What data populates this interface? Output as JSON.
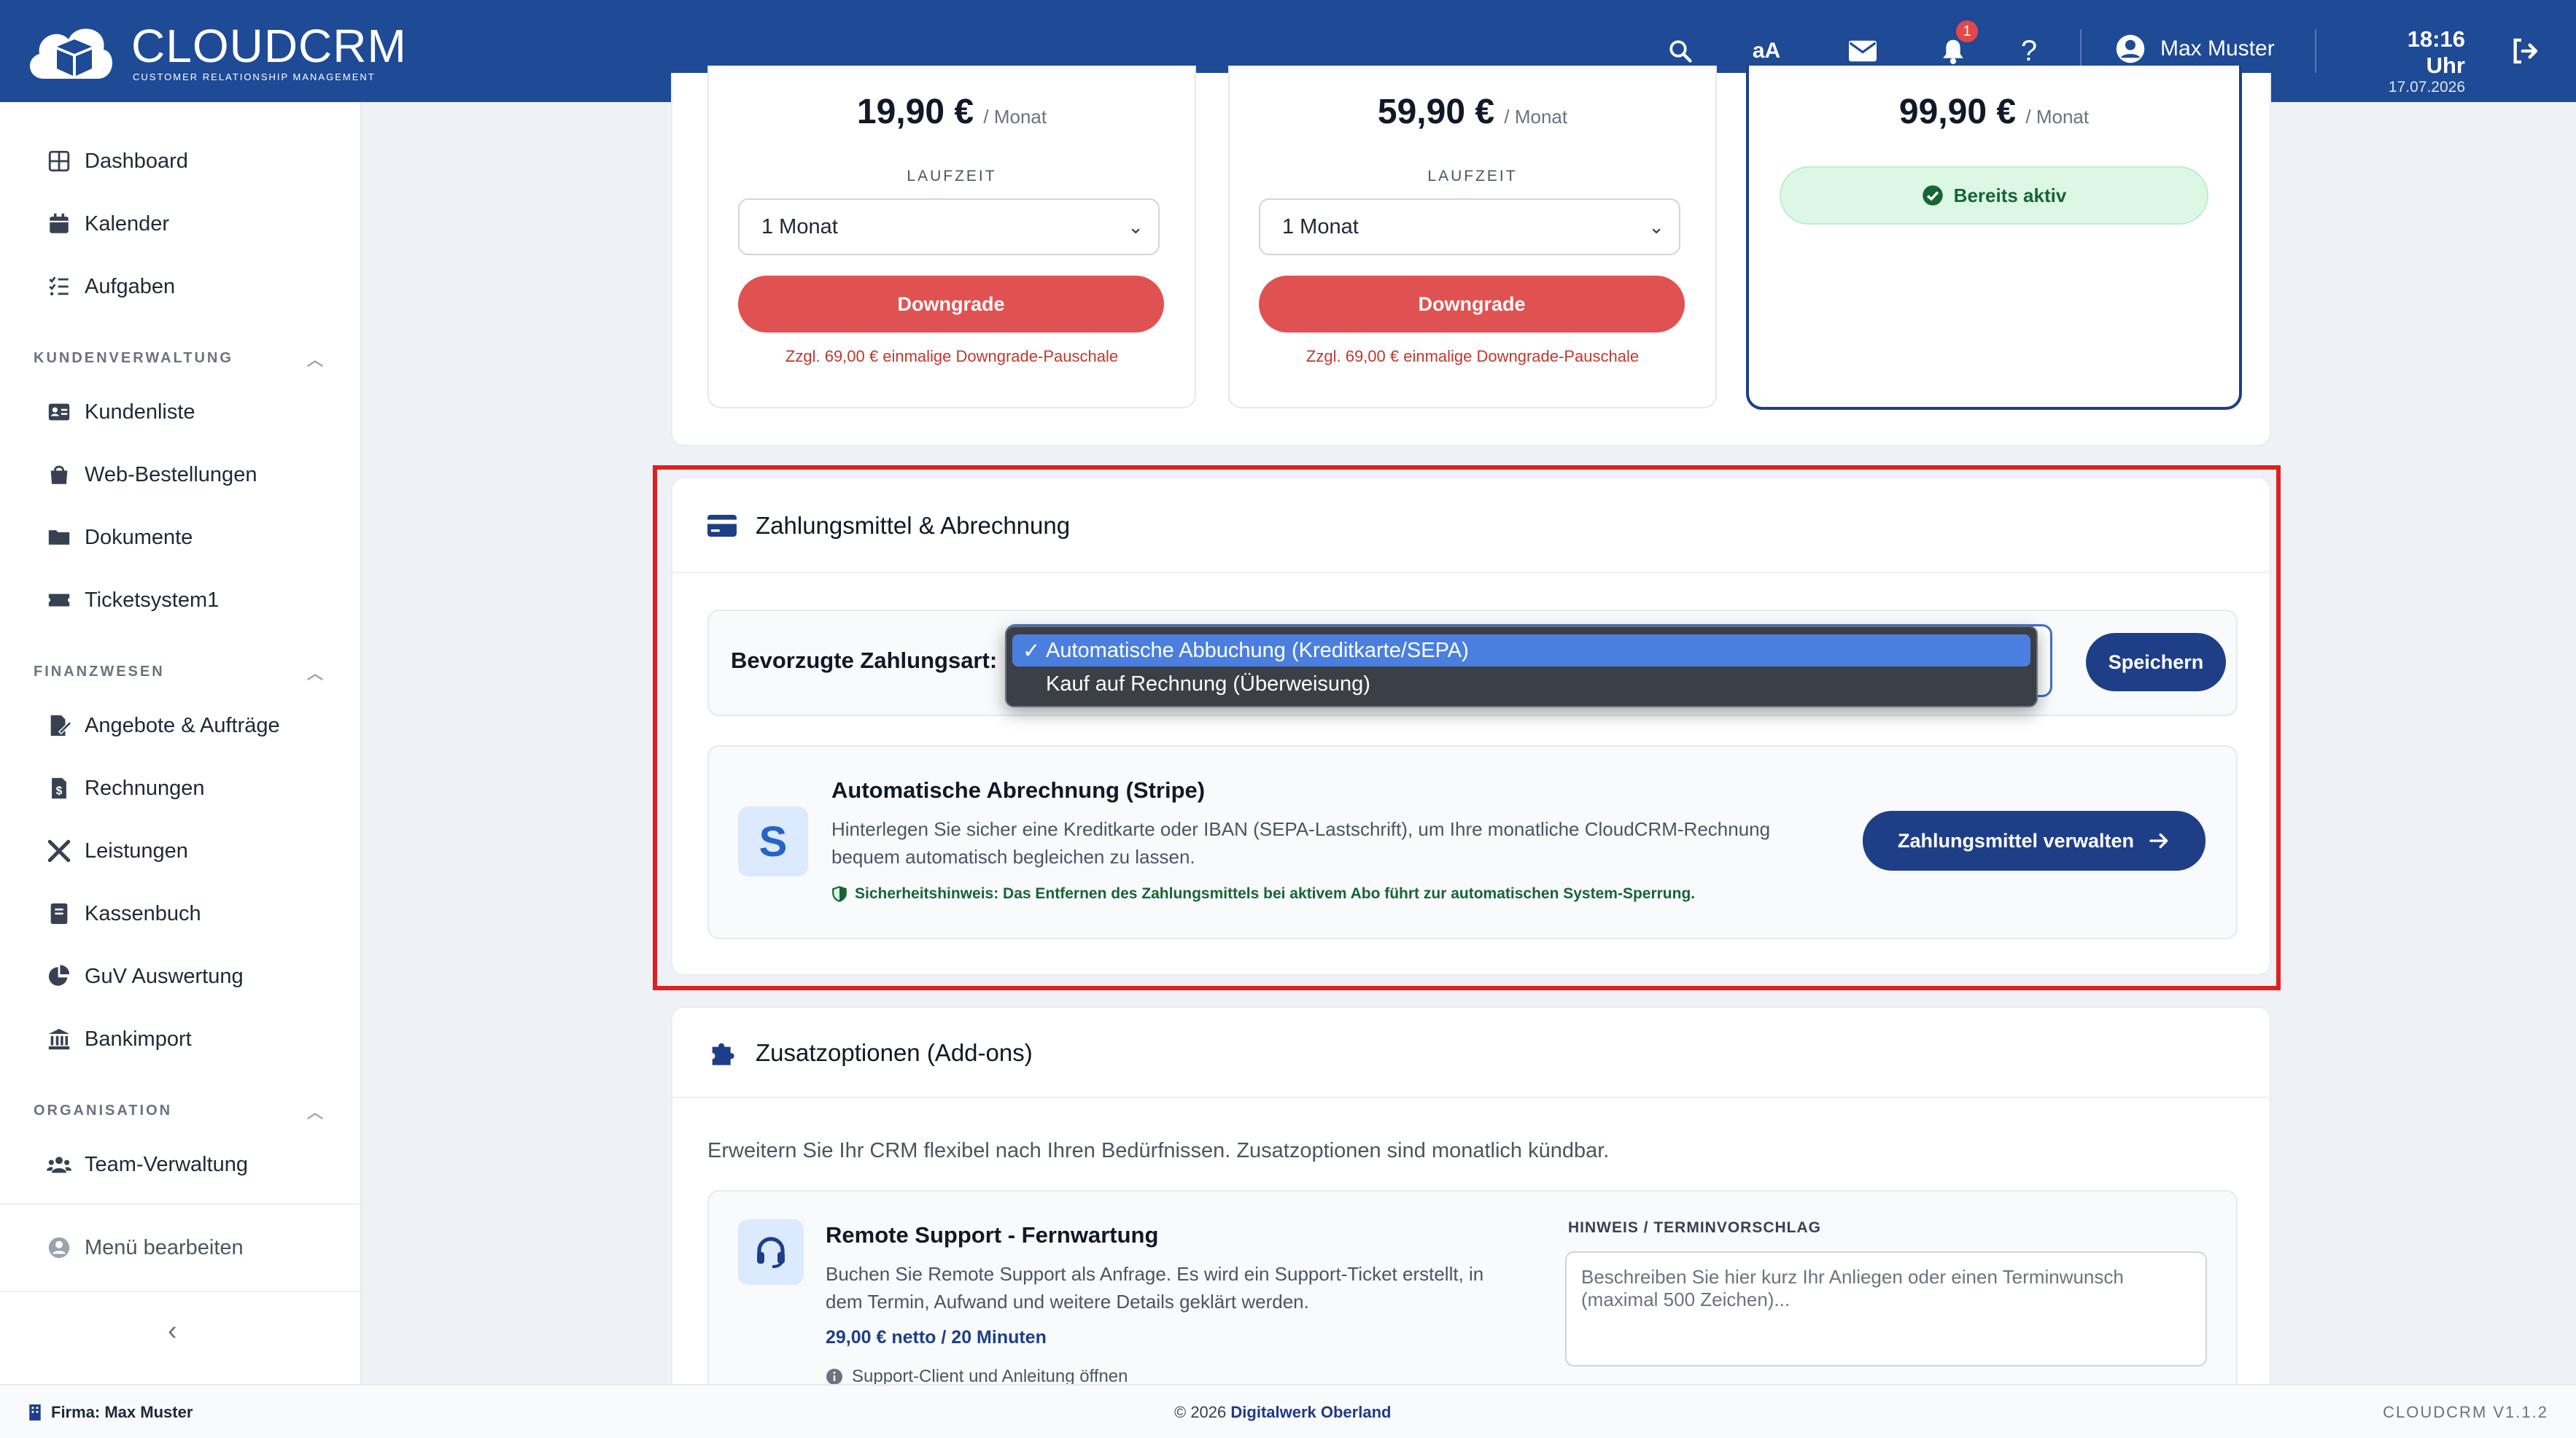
{
  "brand": {
    "title": "CLOUDCRM",
    "subtitle": "CUSTOMER RELATIONSHIP MANAGEMENT"
  },
  "topbar": {
    "font_size_label": "aA",
    "notification_count": "1",
    "help_label": "?",
    "user_name": "Max Muster",
    "time": "18:16 Uhr",
    "date": "17.07.2026"
  },
  "sidebar": {
    "items_top": [
      {
        "label": "Dashboard",
        "icon": "dashboard-icon"
      },
      {
        "label": "Kalender",
        "icon": "calendar-icon"
      },
      {
        "label": "Aufgaben",
        "icon": "tasks-icon"
      }
    ],
    "section_customers": "KUNDENVERWALTUNG",
    "items_customers": [
      {
        "label": "Kundenliste",
        "icon": "address-card-icon"
      },
      {
        "label": "Web-Bestellungen",
        "icon": "shopping-bag-icon"
      },
      {
        "label": "Dokumente",
        "icon": "folder-icon"
      },
      {
        "label": "Ticketsystem1",
        "icon": "ticket-icon"
      }
    ],
    "section_finance": "FINANZWESEN",
    "items_finance": [
      {
        "label": "Angebote & Aufträge",
        "icon": "file-signature-icon"
      },
      {
        "label": "Rechnungen",
        "icon": "invoice-icon"
      },
      {
        "label": "Leistungen",
        "icon": "tools-icon"
      },
      {
        "label": "Kassenbuch",
        "icon": "book-icon"
      },
      {
        "label": "GuV Auswertung",
        "icon": "pie-chart-icon"
      },
      {
        "label": "Bankimport",
        "icon": "bank-icon"
      }
    ],
    "section_org": "ORGANISATION",
    "items_org": [
      {
        "label": "Team-Verwaltung",
        "icon": "users-icon"
      }
    ],
    "edit_menu": "Menü bearbeiten"
  },
  "plans": [
    {
      "price": "19,90 €",
      "per": "/ Monat",
      "duration_label": "LAUFZEIT",
      "duration": "1 Monat",
      "button": "Downgrade",
      "note": "Zzgl. 69,00 € einmalige Downgrade-Pauschale"
    },
    {
      "price": "59,90 €",
      "per": "/ Monat",
      "duration_label": "LAUFZEIT",
      "duration": "1 Monat",
      "button": "Downgrade",
      "note": "Zzgl. 69,00 € einmalige Downgrade-Pauschale"
    },
    {
      "price": "99,90 €",
      "per": "/ Monat",
      "status": "Bereits aktiv"
    }
  ],
  "payment": {
    "title": "Zahlungsmittel & Abrechnung",
    "preferred_label": "Bevorzugte Zahlungsart:",
    "options": [
      "Automatische Abbuchung (Kreditkarte/SEPA)",
      "Kauf auf Rechnung (Überweisung)"
    ],
    "selected_check": "✓",
    "save_button": "Speichern",
    "stripe_title": "Automatische Abrechnung (Stripe)",
    "stripe_logo": "S",
    "stripe_desc_1": "Hinterlegen Sie sicher eine Kreditkarte oder IBAN (SEPA-Lastschrift), um Ihre monatliche CloudCRM-Rechnung",
    "stripe_desc_2": "bequem automatisch begleichen zu lassen.",
    "security_note": "Sicherheitshinweis: Das Entfernen des Zahlungsmittels bei aktivem Abo führt zur automatischen System-Sperrung.",
    "manage_button": "Zahlungsmittel verwalten"
  },
  "addons": {
    "title": "Zusatzoptionen (Add-ons)",
    "intro": "Erweitern Sie Ihr CRM flexibel nach Ihren Bedürfnissen. Zusatzoptionen sind monatlich kündbar.",
    "remote": {
      "title": "Remote Support - Fernwartung",
      "desc_1": "Buchen Sie Remote Support als Anfrage. Es wird ein Support-Ticket erstellt, in",
      "desc_2": "dem Termin, Aufwand und weitere Details geklärt werden.",
      "price": "29,00 € netto / 20 Minuten",
      "client_link": "Support-Client und Anleitung öffnen",
      "hint_label": "HINWEIS / TERMINVORSCHLAG",
      "hint_placeholder": "Beschreiben Sie hier kurz Ihr Anliegen oder einen Terminwunsch (maximal 500 Zeichen)..."
    }
  },
  "footer": {
    "company": "Firma: Max Muster",
    "copyright": "© 2026",
    "copyright_owner": "Digitalwerk Oberland",
    "version": "CLOUDCRM V1.1.2"
  },
  "colors": {
    "primary": "#1e4a96",
    "danger": "#e05252",
    "success_bg": "#dcf8e5",
    "highlight": "#e02020"
  }
}
